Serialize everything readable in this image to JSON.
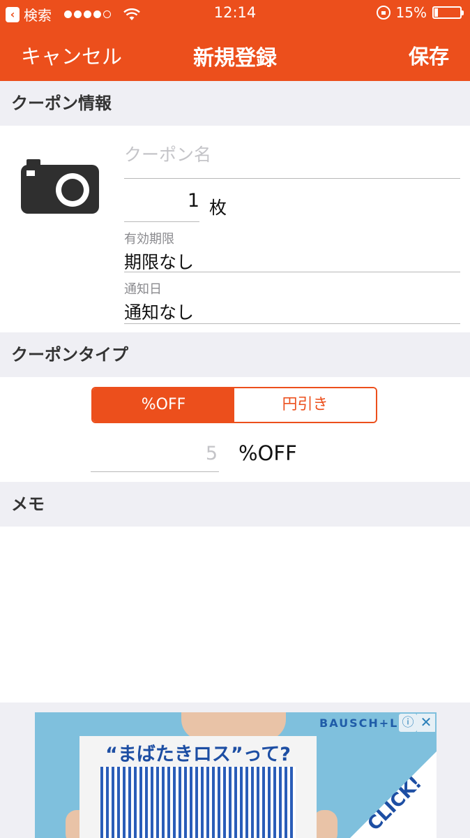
{
  "status_bar": {
    "back_app": "検索",
    "signal_dots": [
      "full",
      "full",
      "full",
      "full",
      "empty"
    ],
    "time": "12:14",
    "battery_text": "15%",
    "battery_level": 0.15
  },
  "nav": {
    "cancel_label": "キャンセル",
    "title": "新規登録",
    "save_label": "保存"
  },
  "sections": {
    "coupon_info": "クーポン情報",
    "coupon_type": "クーポンタイプ",
    "memo": "メモ"
  },
  "coupon": {
    "name_placeholder": "クーポン名",
    "count": "1",
    "count_unit": "枚",
    "expiry_label": "有効期限",
    "expiry_value": "期限なし",
    "notify_label": "通知日",
    "notify_value": "通知なし"
  },
  "coupon_type": {
    "options": [
      "%OFF",
      "円引き"
    ],
    "selected": "%OFF",
    "amount_placeholder": "5",
    "amount_unit": "%OFF"
  },
  "memo": {
    "value": ""
  },
  "ad": {
    "brand": "BAUSCH+L",
    "headline": "“まばたきロス”って?",
    "cta": "CLICK!",
    "info_icon": "ⓘ",
    "close_icon": "✕"
  },
  "colors": {
    "accent": "#ec4f1c",
    "background": "#efeff4",
    "placeholder": "#c4c4c8"
  }
}
